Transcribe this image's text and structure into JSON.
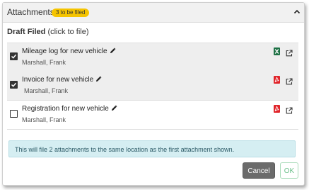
{
  "header": {
    "title": "Attachments",
    "badge": "3 to be filed"
  },
  "section": {
    "title_bold": "Draft Filed",
    "title_hint": " (click to file)"
  },
  "attachments": [
    {
      "name": "Mileage log for new vehicle",
      "owner": "Marshall, Frank",
      "checked": true,
      "file_type": "excel-icon"
    },
    {
      "name": "Invoice for new vehicle",
      "owner": "Marshall, Frank",
      "checked": true,
      "file_type": "pdf-icon"
    },
    {
      "name": "Registration for new vehicle",
      "owner": "Marshall, Frank",
      "checked": false,
      "file_type": "pdf-icon"
    }
  ],
  "info": {
    "message": "This will file 2 attachments to the same location as the first attachment shown."
  },
  "buttons": {
    "cancel_label": "Cancel",
    "ok_label": "OK"
  },
  "colors": {
    "badge": "#f5c400",
    "excel": "#1e7145",
    "pdf": "#e0242a",
    "info_bg": "#d5eef2",
    "cancel_bg": "#6b6b6b",
    "ok_text": "#6cc08a"
  }
}
